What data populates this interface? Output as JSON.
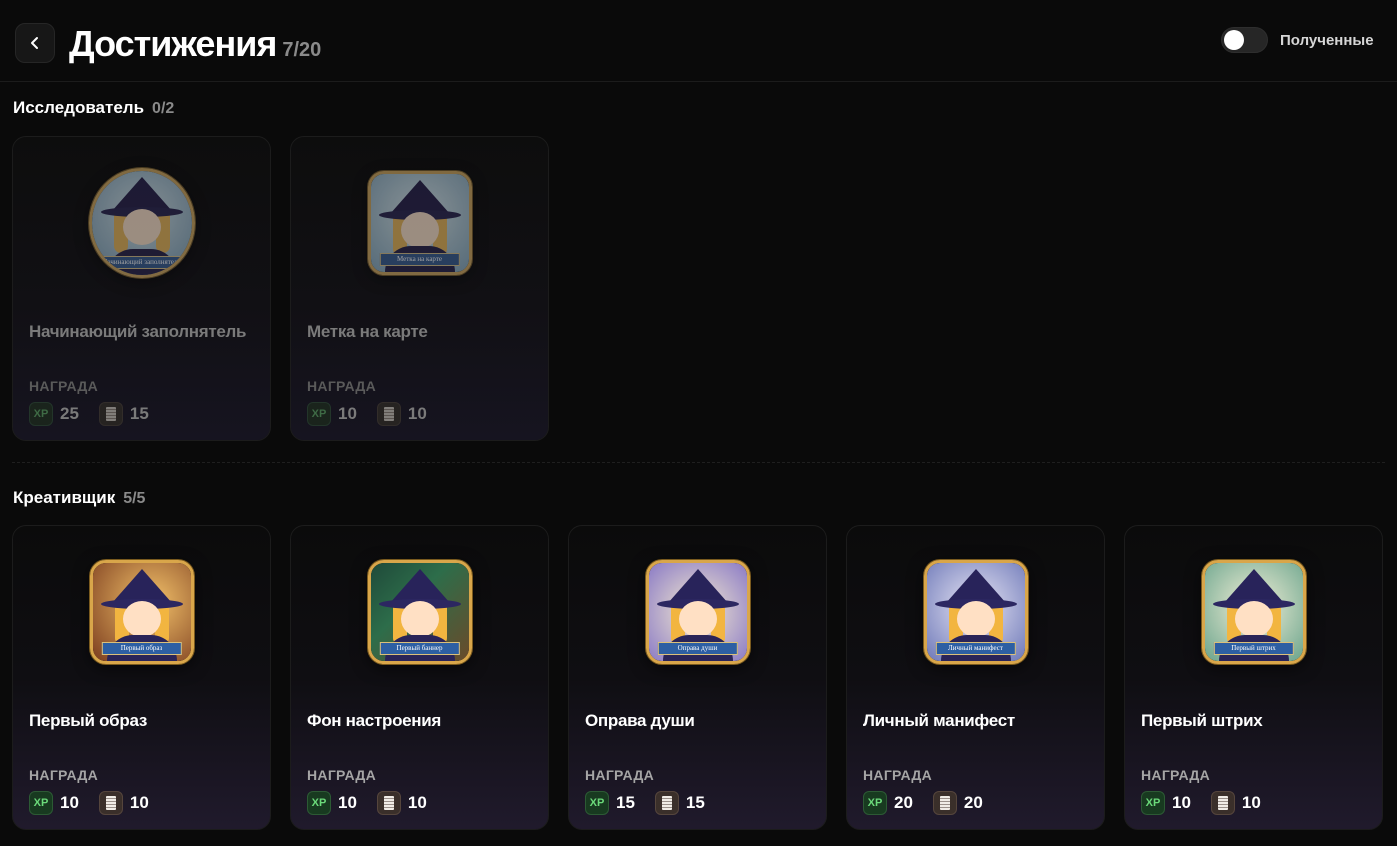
{
  "header": {
    "title": "Достижения",
    "count": "7/20",
    "toggle_label": "Полученные",
    "toggle_on": false
  },
  "colors": {
    "xp": "#6bd97a",
    "badge_gold": "#d9a64a",
    "ribbon": "#2d5fa3"
  },
  "sections": [
    {
      "title": "Исследователь",
      "count": "0/2",
      "cards": [
        {
          "title": "Начинающий заполнятель",
          "badge_ribbon": "Начинающий заполнятель",
          "shape": "round",
          "reward_label": "НАГРАДА",
          "xp_icon": "XP",
          "xp": "25",
          "coins": "15",
          "locked": true,
          "bg": "radial-gradient(circle at 50% 40%, #cfe6f0, #6fa0c0)"
        },
        {
          "title": "Метка на карте",
          "badge_ribbon": "Метка на карте",
          "shape": "square",
          "reward_label": "НАГРАДА",
          "xp_icon": "XP",
          "xp": "10",
          "coins": "10",
          "locked": true,
          "bg": "radial-gradient(circle at 50% 40%, #d8ecf4, #7aaac6)"
        }
      ]
    },
    {
      "title": "Креативщик",
      "count": "5/5",
      "cards": [
        {
          "title": "Первый образ",
          "badge_ribbon": "Первый образ",
          "shape": "square",
          "reward_label": "НАГРАДА",
          "xp_icon": "XP",
          "xp": "10",
          "coins": "10",
          "locked": false,
          "bg": "radial-gradient(circle at 60% 40%, #f3c26a, #7a3b1e)"
        },
        {
          "title": "Фон настроения",
          "badge_ribbon": "Первый баннер",
          "shape": "square",
          "reward_label": "НАГРАДА",
          "xp_icon": "XP",
          "xp": "10",
          "coins": "10",
          "locked": false,
          "bg": "linear-gradient(135deg, #1f4a3a, #2d6d4a 40%, #6a4a2a)"
        },
        {
          "title": "Оправа души",
          "badge_ribbon": "Оправа души",
          "shape": "square",
          "reward_label": "НАГРАДА",
          "xp_icon": "XP",
          "xp": "15",
          "coins": "15",
          "locked": false,
          "bg": "radial-gradient(circle at 50% 50%, #f6ecd0, #8a7ac6)"
        },
        {
          "title": "Личный манифест",
          "badge_ribbon": "Личный манифест",
          "shape": "square",
          "reward_label": "НАГРАДА",
          "xp_icon": "XP",
          "xp": "20",
          "coins": "20",
          "locked": false,
          "bg": "radial-gradient(circle at 50% 45%, #e8e6f4, #6d78b8)"
        },
        {
          "title": "Первый штрих",
          "badge_ribbon": "Первый штрих",
          "shape": "square",
          "reward_label": "НАГРАДА",
          "xp_icon": "XP",
          "xp": "10",
          "coins": "10",
          "locked": false,
          "bg": "radial-gradient(circle at 50% 45%, #f4f0d8, #6aa48c)"
        }
      ]
    }
  ]
}
